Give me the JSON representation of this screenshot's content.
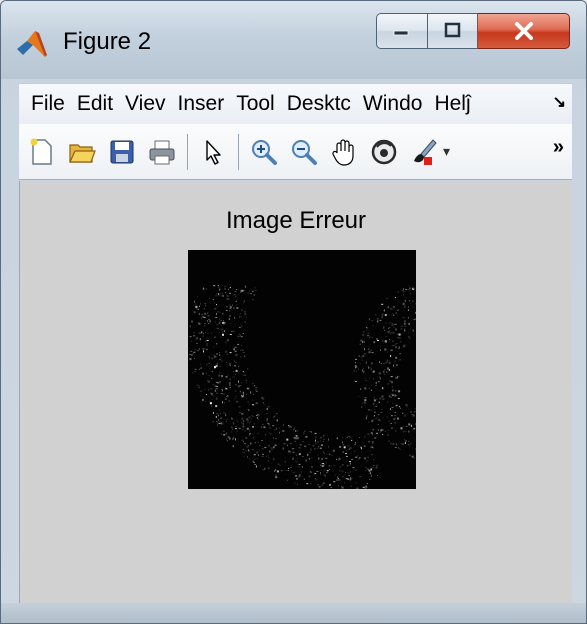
{
  "window": {
    "title": "Figure 2"
  },
  "menu": {
    "items": [
      "File",
      "Edit",
      "Viev",
      "Inser",
      "Tool",
      "Desktc",
      "Windo",
      "Helĵ"
    ],
    "overflow_glyph": "↘"
  },
  "toolbar": {
    "buttons": [
      {
        "icon": "new-figure-icon"
      },
      {
        "icon": "open-file-icon"
      },
      {
        "icon": "save-icon"
      },
      {
        "icon": "print-icon"
      },
      {
        "icon": "select-arrow-icon"
      },
      {
        "icon": "zoom-in-icon"
      },
      {
        "icon": "zoom-out-icon"
      },
      {
        "icon": "pan-hand-icon"
      },
      {
        "icon": "rotate-3d-icon"
      },
      {
        "icon": "data-brush-icon"
      }
    ],
    "more_glyph": "»",
    "dropdown_glyph": "▾"
  },
  "figure": {
    "plot_title": "Image Erreur",
    "image_background": "#030303"
  },
  "colors": {
    "canvas": "#d1d1d1",
    "close_button": "#c6381d"
  }
}
